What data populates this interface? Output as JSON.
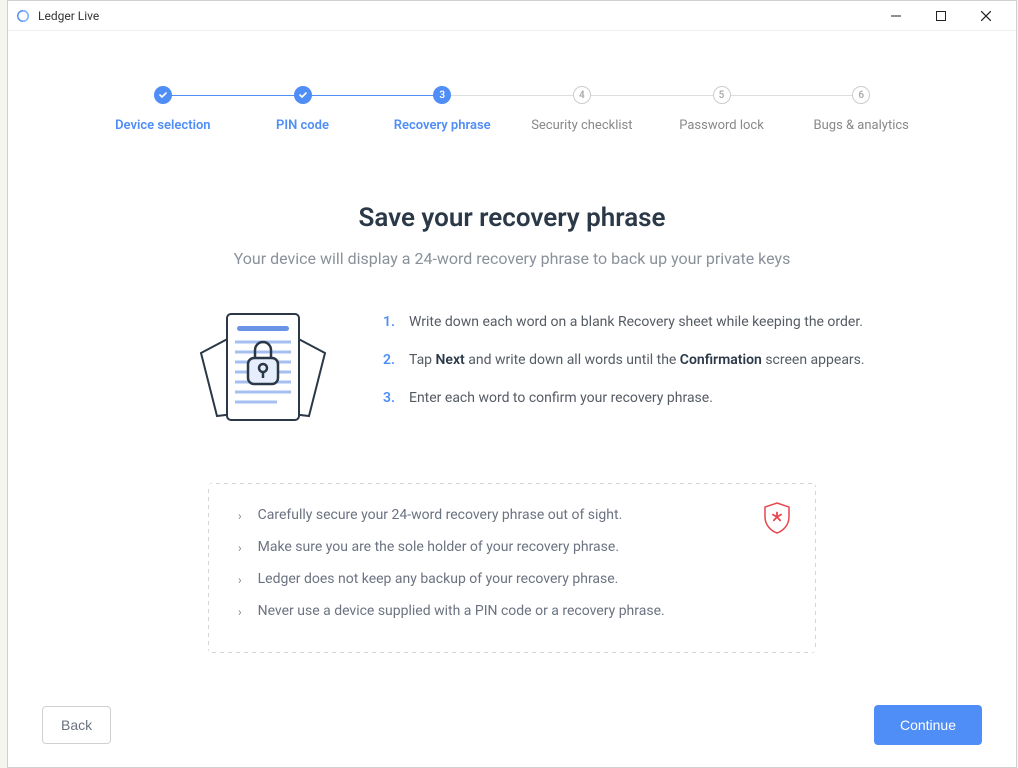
{
  "window": {
    "title": "Ledger Live"
  },
  "stepper": {
    "steps": [
      {
        "label": "Device selection",
        "state": "completed"
      },
      {
        "label": "PIN code",
        "state": "completed"
      },
      {
        "label": "Recovery phrase",
        "state": "active",
        "num": "3"
      },
      {
        "label": "Security checklist",
        "state": "inactive",
        "num": "4"
      },
      {
        "label": "Password lock",
        "state": "inactive",
        "num": "5"
      },
      {
        "label": "Bugs & analytics",
        "state": "inactive",
        "num": "6"
      }
    ]
  },
  "main": {
    "heading": "Save your recovery phrase",
    "subheading": "Your device will display a 24-word recovery phrase to back up your private keys",
    "instructions": [
      {
        "num": "1.",
        "pre": "Write down each word on a blank Recovery sheet while keeping the order."
      },
      {
        "num": "2.",
        "pre": "Tap ",
        "b1": "Next",
        "mid": " and write down all words until the ",
        "b2": "Confirmation",
        "post": " screen appears."
      },
      {
        "num": "3.",
        "pre": "Enter each word to confirm your recovery phrase."
      }
    ],
    "warnings": [
      "Carefully secure your 24-word recovery phrase out of sight.",
      "Make sure you are the sole holder of your recovery phrase.",
      "Ledger does not keep any backup of your recovery phrase.",
      "Never use a device supplied with a PIN code or a recovery phrase."
    ]
  },
  "buttons": {
    "back": "Back",
    "continue": "Continue"
  }
}
